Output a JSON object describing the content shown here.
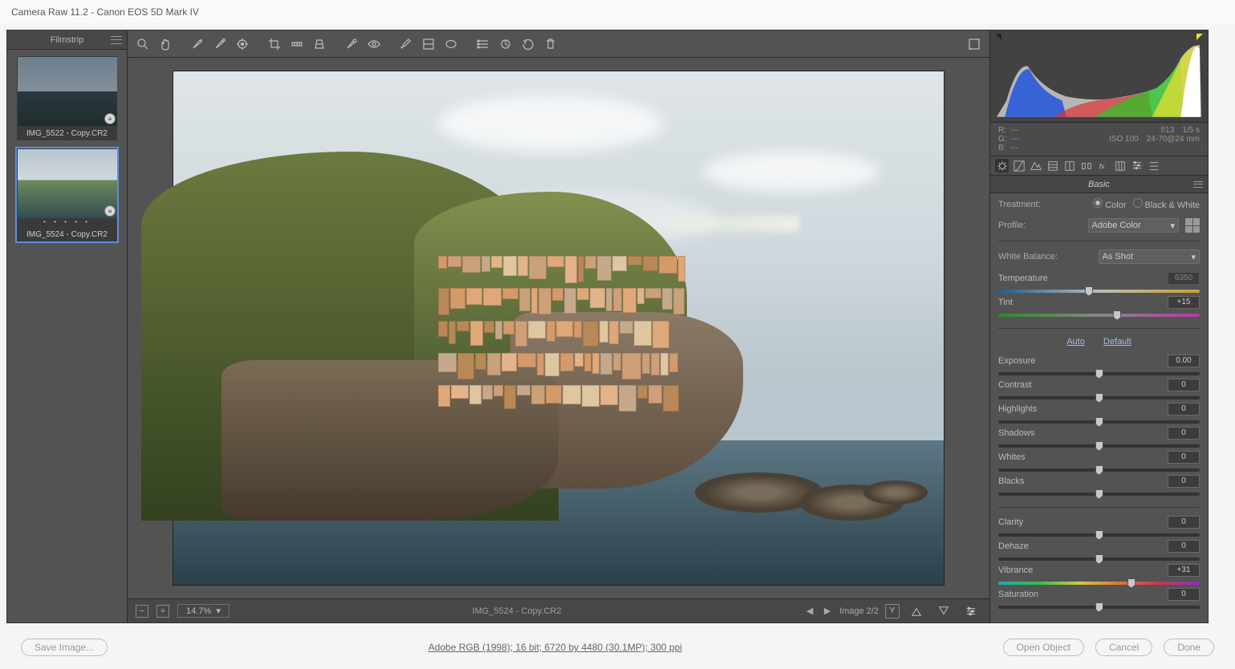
{
  "titlebar": "Camera Raw 11.2  -  Canon EOS 5D Mark IV",
  "filmstrip": {
    "title": "Filmstrip",
    "items": [
      {
        "label": "IMG_5522 - Copy.CR2",
        "selected": false
      },
      {
        "label": "IMG_5524 - Copy.CR2",
        "selected": true
      }
    ]
  },
  "footer": {
    "zoom": "14.7%",
    "filename": "IMG_5524 - Copy.CR2",
    "position": "Image 2/2"
  },
  "readouts": {
    "r_label": "R:",
    "r_val": "---",
    "g_label": "G:",
    "g_val": "---",
    "b_label": "B:",
    "b_val": "---",
    "aperture": "f/13",
    "shutter": "1/5 s",
    "iso": "ISO 100",
    "lens": "24-70@24 mm"
  },
  "panel": {
    "title": "Basic",
    "treatment_label": "Treatment:",
    "treat_color": "Color",
    "treat_bw": "Black & White",
    "profile_label": "Profile:",
    "profile_value": "Adobe Color",
    "wb_label": "White Balance:",
    "wb_value": "As Shot",
    "auto": "Auto",
    "default": "Default",
    "sliders": {
      "temperature": {
        "label": "Temperature",
        "value": "6350",
        "pos": 45,
        "grad": "grad-bw",
        "dim": true
      },
      "tint": {
        "label": "Tint",
        "value": "+15",
        "pos": 59,
        "grad": "grad-tint"
      },
      "exposure": {
        "label": "Exposure",
        "value": "0.00",
        "pos": 50
      },
      "contrast": {
        "label": "Contrast",
        "value": "0",
        "pos": 50
      },
      "highlights": {
        "label": "Highlights",
        "value": "0",
        "pos": 50
      },
      "shadows": {
        "label": "Shadows",
        "value": "0",
        "pos": 50
      },
      "whites": {
        "label": "Whites",
        "value": "0",
        "pos": 50
      },
      "blacks": {
        "label": "Blacks",
        "value": "0",
        "pos": 50
      },
      "clarity": {
        "label": "Clarity",
        "value": "0",
        "pos": 50
      },
      "dehaze": {
        "label": "Dehaze",
        "value": "0",
        "pos": 50
      },
      "vibrance": {
        "label": "Vibrance",
        "value": "+31",
        "pos": 66,
        "grad": "grad-vib"
      },
      "saturation": {
        "label": "Saturation",
        "value": "0",
        "pos": 50
      }
    }
  },
  "bottombar": {
    "save": "Save Image...",
    "meta": "Adobe RGB (1998); 16 bit; 6720 by 4480 (30.1MP); 300 ppi",
    "open": "Open Object",
    "cancel": "Cancel",
    "done": "Done"
  }
}
